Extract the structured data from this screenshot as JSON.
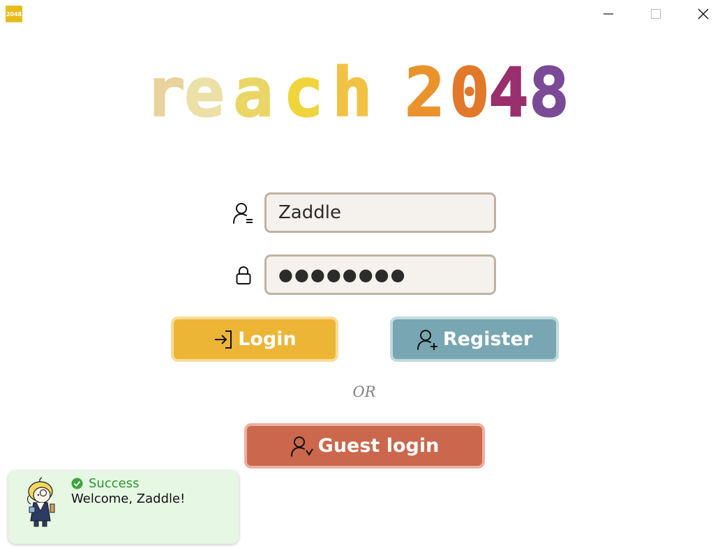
{
  "window": {
    "app_icon_text": "2048",
    "minimize_icon": "minimize-icon",
    "maximize_icon": "maximize-icon",
    "close_icon": "close-icon"
  },
  "logo": {
    "word1": "reach",
    "word2": "2048",
    "letter_colors": [
      "#e9d29b",
      "#ece0a6",
      "#ead667",
      "#efd43b",
      "#f0c347",
      "#ea932d",
      "#e2782a",
      "#9a2f6d",
      "#7b4a97",
      "#7ea6b5"
    ]
  },
  "form": {
    "username_icon": "user-icon",
    "username_value": "Zaddle",
    "password_icon": "lock-icon",
    "password_value": "●●●●●●●●"
  },
  "buttons": {
    "login_label": "Login",
    "login_icon": "login-arrow-icon",
    "register_label": "Register",
    "register_icon": "add-user-icon",
    "or_text": "OR",
    "guest_label": "Guest login",
    "guest_icon": "guest-user-icon"
  },
  "colors": {
    "login": "#ecb536",
    "register": "#78a6b2",
    "guest": "#cb674c",
    "toast_bg": "#e6f7e3",
    "success": "#2f9431"
  },
  "toast": {
    "icon": "check-circle-icon",
    "title": "Success",
    "message": "Welcome, Zaddle!",
    "avatar": "chibi-avatar"
  }
}
